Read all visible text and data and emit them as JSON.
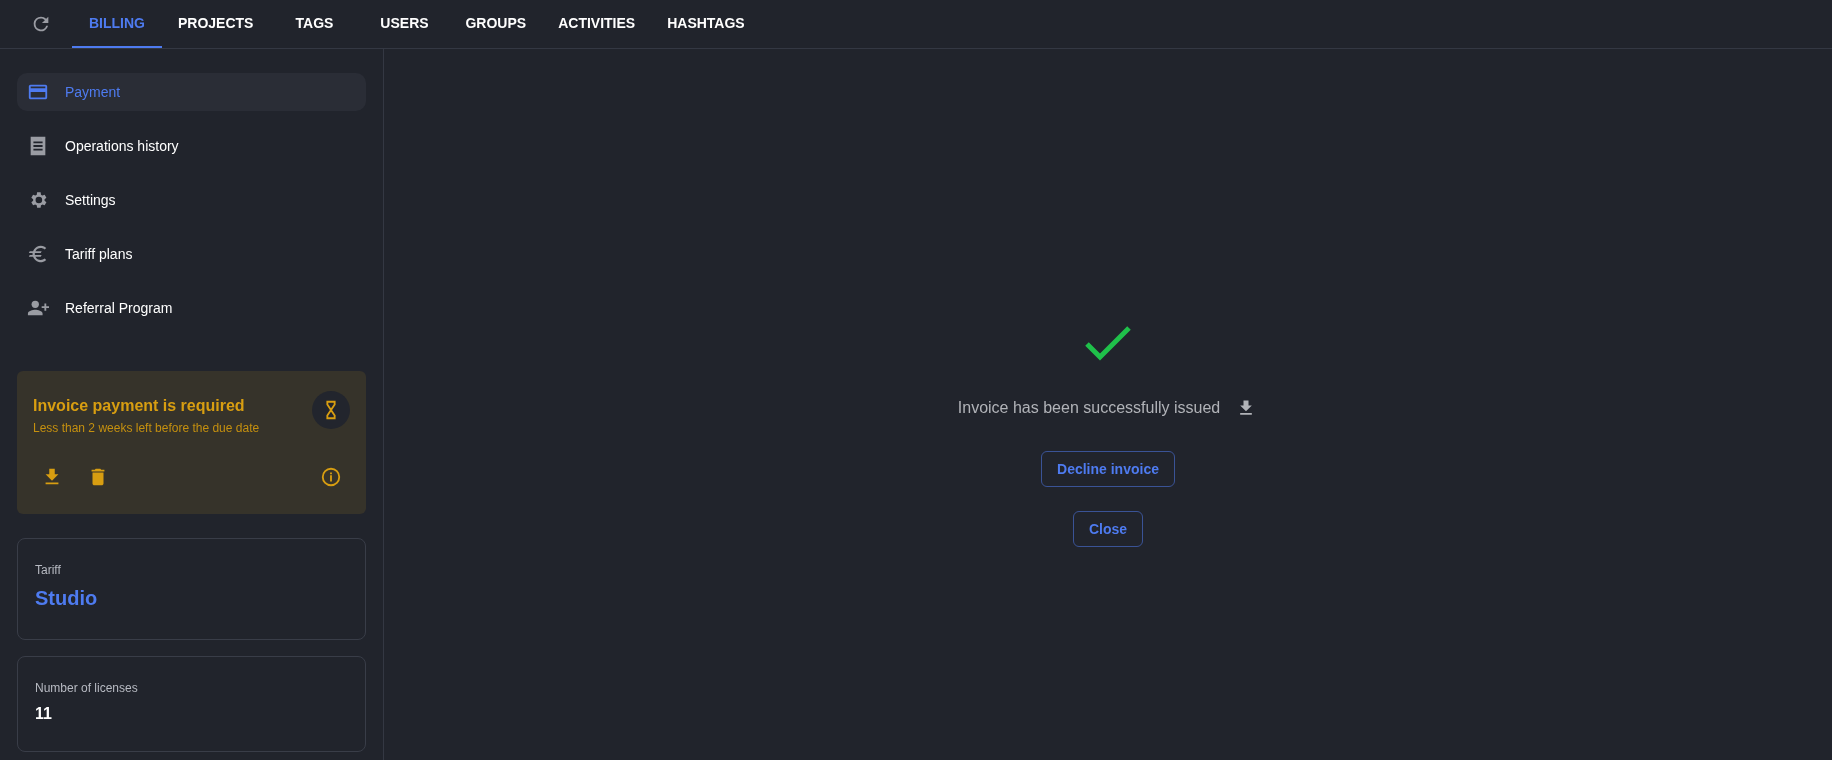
{
  "tabs": [
    {
      "label": "BILLING",
      "selected": true
    },
    {
      "label": "PROJECTS",
      "selected": false
    },
    {
      "label": "TAGS",
      "selected": false
    },
    {
      "label": "USERS",
      "selected": false
    },
    {
      "label": "GROUPS",
      "selected": false
    },
    {
      "label": "ACTIVITIES",
      "selected": false
    },
    {
      "label": "HASHTAGS",
      "selected": false
    }
  ],
  "sidebar": {
    "items": [
      {
        "label": "Payment",
        "selected": true
      },
      {
        "label": "Operations history",
        "selected": false
      },
      {
        "label": "Settings",
        "selected": false
      },
      {
        "label": "Tariff plans",
        "selected": false
      },
      {
        "label": "Referral Program",
        "selected": false
      }
    ],
    "alert": {
      "title": "Invoice payment is required",
      "subtitle": "Less than 2 weeks left before the due date"
    },
    "cards": [
      {
        "label": "Tariff",
        "value": "Studio",
        "kind": "accent"
      },
      {
        "label": "Number of licenses",
        "value": "11",
        "kind": "plain"
      }
    ]
  },
  "main": {
    "message": "Invoice has been successfully issued",
    "buttons": [
      "Decline invoice",
      "Close"
    ]
  }
}
